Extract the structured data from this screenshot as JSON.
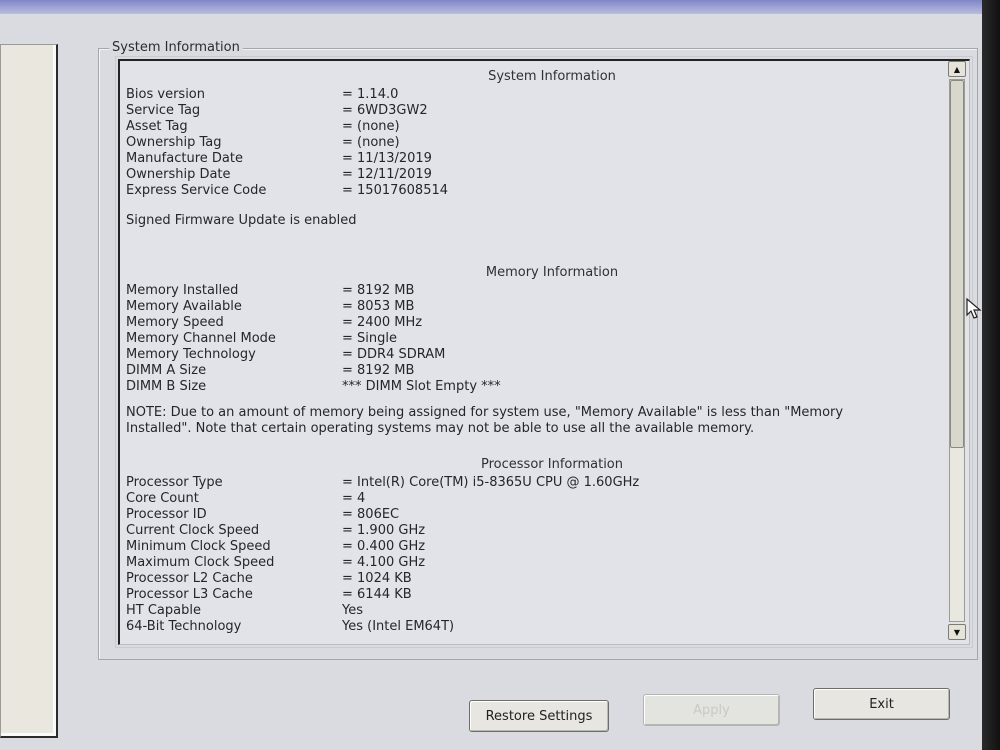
{
  "groupbox": {
    "title": "System Information"
  },
  "system": {
    "title": "System Information",
    "rows": [
      {
        "label": "Bios version",
        "value": "= 1.14.0"
      },
      {
        "label": "Service Tag",
        "value": "= 6WD3GW2"
      },
      {
        "label": "Asset Tag",
        "value": "= (none)"
      },
      {
        "label": "Ownership Tag",
        "value": "= (none)"
      },
      {
        "label": "Manufacture Date",
        "value": "= 11/13/2019"
      },
      {
        "label": "Ownership Date",
        "value": "= 12/11/2019"
      },
      {
        "label": "Express Service Code",
        "value": "= 15017608514"
      }
    ],
    "firmware_note": "Signed Firmware Update is enabled"
  },
  "memory": {
    "title": "Memory Information",
    "rows": [
      {
        "label": "Memory Installed",
        "value": "= 8192 MB"
      },
      {
        "label": "Memory Available",
        "value": "= 8053 MB"
      },
      {
        "label": "Memory Speed",
        "value": "= 2400 MHz"
      },
      {
        "label": "Memory Channel Mode",
        "value": "= Single"
      },
      {
        "label": "Memory Technology",
        "value": "= DDR4 SDRAM"
      },
      {
        "label": "DIMM A Size",
        "value": "= 8192 MB"
      },
      {
        "label": "DIMM B Size",
        "value": "*** DIMM Slot Empty ***"
      }
    ],
    "note": "NOTE: Due to an amount of memory being assigned for system use, \"Memory Available\" is less than \"Memory Installed\". Note that certain operating systems may not be able to use all the available memory."
  },
  "processor": {
    "title": "Processor Information",
    "rows": [
      {
        "label": "Processor Type",
        "value": "= Intel(R) Core(TM) i5-8365U CPU @ 1.60GHz"
      },
      {
        "label": "Core Count",
        "value": "= 4"
      },
      {
        "label": "Processor ID",
        "value": "= 806EC"
      },
      {
        "label": "Current Clock Speed",
        "value": "= 1.900 GHz"
      },
      {
        "label": "Minimum Clock Speed",
        "value": "= 0.400 GHz"
      },
      {
        "label": "Maximum Clock Speed",
        "value": "= 4.100 GHz"
      },
      {
        "label": "Processor L2 Cache",
        "value": "= 1024 KB"
      },
      {
        "label": "Processor L3 Cache",
        "value": "= 6144 KB"
      },
      {
        "label": "HT Capable",
        "value": "Yes"
      },
      {
        "label": "64-Bit Technology",
        "value": "Yes (Intel EM64T)"
      }
    ]
  },
  "scrollbar": {
    "position": 0.0,
    "visible_fraction": 0.68,
    "up_icon": "triangle-up",
    "down_icon": "triangle-down"
  },
  "buttons": {
    "restore": "Restore Settings",
    "apply": "Apply",
    "exit": "Exit"
  }
}
